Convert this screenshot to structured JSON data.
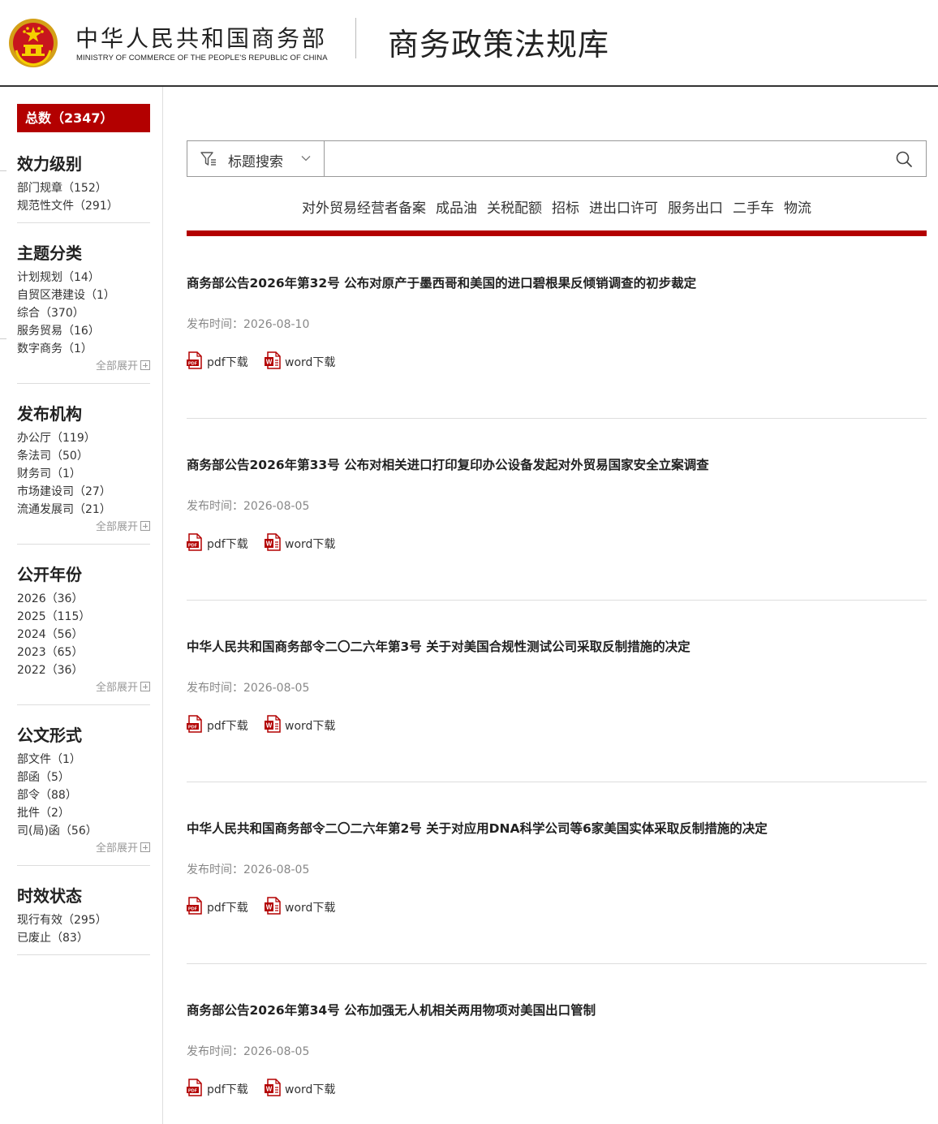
{
  "header": {
    "ministry_cn": "中华人民共和国商务部",
    "ministry_en": "MINISTRY OF COMMERCE OF THE PEOPLE'S REPUBLIC OF CHINA",
    "site_title": "商务政策法规库",
    "emblem_icon": "national-emblem-icon"
  },
  "sidebar": {
    "total_label": "总数（2347）",
    "expand_label": "全部展开",
    "facets": [
      {
        "title": "效力级别",
        "items": [
          "部门规章（152）",
          "规范性文件（291）"
        ],
        "has_expand": false
      },
      {
        "title": "主题分类",
        "items": [
          "计划规划（14）",
          "自贸区港建设（1）",
          "综合（370）",
          "服务贸易（16）",
          "数字商务（1）"
        ],
        "has_expand": true
      },
      {
        "title": "发布机构",
        "items": [
          "办公厅（119）",
          "条法司（50）",
          "财务司（1）",
          "市场建设司（27）",
          "流通发展司（21）"
        ],
        "has_expand": true
      },
      {
        "title": "公开年份",
        "items": [
          "2026（36）",
          "2025（115）",
          "2024（56）",
          "2023（65）",
          "2022（36）"
        ],
        "has_expand": true
      },
      {
        "title": "公文形式",
        "items": [
          "部文件（1）",
          "部函（5）",
          "部令（88）",
          "批件（2）",
          "司(局)函（56）"
        ],
        "has_expand": true
      },
      {
        "title": "时效状态",
        "items": [
          "现行有效（295）",
          "已废止（83）"
        ],
        "has_expand": false
      }
    ]
  },
  "search": {
    "type_label": "标题搜索",
    "value": "",
    "placeholder": ""
  },
  "quick_tags": [
    "对外贸易经营者备案",
    "成品油",
    "关税配额",
    "招标",
    "进出口许可",
    "服务出口",
    "二手车",
    "物流"
  ],
  "articles": [
    {
      "title": "商务部公告2026年第32号 公布对原产于墨西哥和美国的进口碧根果反倾销调查的初步裁定",
      "date": "发布时间：2026-08-10",
      "pdf": "pdf下载",
      "word": "word下载"
    },
    {
      "title": "商务部公告2026年第33号 公布对相关进口打印复印办公设备发起对外贸易国家安全立案调查",
      "date": "发布时间：2026-08-05",
      "pdf": "pdf下载",
      "word": "word下载"
    },
    {
      "title": "中华人民共和国商务部令二〇二六年第3号 关于对美国合规性测试公司采取反制措施的决定",
      "date": "发布时间：2026-08-05",
      "pdf": "pdf下载",
      "word": "word下载"
    },
    {
      "title": "中华人民共和国商务部令二〇二六年第2号 关于对应用DNA科学公司等6家美国实体采取反制措施的决定",
      "date": "发布时间：2026-08-05",
      "pdf": "pdf下载",
      "word": "word下载"
    },
    {
      "title": "商务部公告2026年第34号 公布加强无人机相关两用物项对美国出口管制",
      "date": "发布时间：2026-08-05",
      "pdf": "pdf下载",
      "word": "word下载"
    }
  ],
  "colors": {
    "accent": "#b30000",
    "text": "#333333",
    "muted": "#888888"
  }
}
